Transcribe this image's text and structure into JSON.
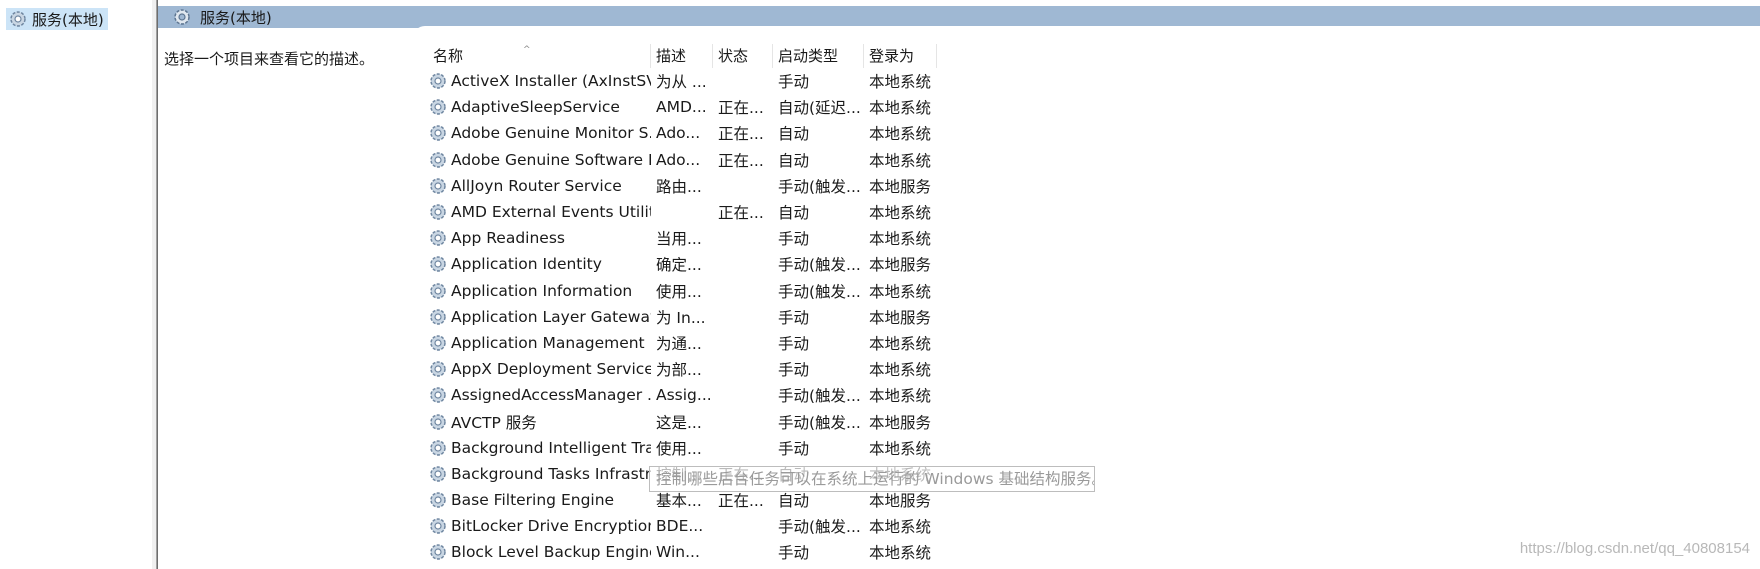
{
  "tree": {
    "root_label": "服务(本地)"
  },
  "header": {
    "title": "服务(本地)"
  },
  "description_panel": {
    "text": "选择一个项目来查看它的描述。"
  },
  "columns": [
    "名称",
    "描述",
    "状态",
    "启动类型",
    "登录为"
  ],
  "services": [
    {
      "name": "ActiveX Installer (AxInstSV)",
      "desc": "为从 ...",
      "status": "",
      "startup": "手动",
      "logon": "本地系统"
    },
    {
      "name": "AdaptiveSleepService",
      "desc": "AMD...",
      "status": "正在...",
      "startup": "自动(延迟...",
      "logon": "本地系统"
    },
    {
      "name": "Adobe Genuine Monitor S...",
      "desc": "Ado...",
      "status": "正在...",
      "startup": "自动",
      "logon": "本地系统"
    },
    {
      "name": "Adobe Genuine Software I...",
      "desc": "Ado...",
      "status": "正在...",
      "startup": "自动",
      "logon": "本地系统"
    },
    {
      "name": "AllJoyn Router Service",
      "desc": "路由...",
      "status": "",
      "startup": "手动(触发...",
      "logon": "本地服务"
    },
    {
      "name": "AMD External Events Utility",
      "desc": "",
      "status": "正在...",
      "startup": "自动",
      "logon": "本地系统"
    },
    {
      "name": "App Readiness",
      "desc": "当用...",
      "status": "",
      "startup": "手动",
      "logon": "本地系统"
    },
    {
      "name": "Application Identity",
      "desc": "确定...",
      "status": "",
      "startup": "手动(触发...",
      "logon": "本地服务"
    },
    {
      "name": "Application Information",
      "desc": "使用...",
      "status": "",
      "startup": "手动(触发...",
      "logon": "本地系统"
    },
    {
      "name": "Application Layer Gateway ...",
      "desc": "为 In...",
      "status": "",
      "startup": "手动",
      "logon": "本地服务"
    },
    {
      "name": "Application Management",
      "desc": "为通...",
      "status": "",
      "startup": "手动",
      "logon": "本地系统"
    },
    {
      "name": "AppX Deployment Service ...",
      "desc": "为部...",
      "status": "",
      "startup": "手动",
      "logon": "本地系统"
    },
    {
      "name": "AssignedAccessManager ...",
      "desc": "Assig...",
      "status": "",
      "startup": "手动(触发...",
      "logon": "本地系统"
    },
    {
      "name": "AVCTP 服务",
      "desc": "这是...",
      "status": "",
      "startup": "手动(触发...",
      "logon": "本地服务"
    },
    {
      "name": "Background Intelligent Tra...",
      "desc": "使用...",
      "status": "",
      "startup": "手动",
      "logon": "本地系统"
    },
    {
      "name": "Background Tasks Infrastru...",
      "desc": "控制...",
      "status": "正在...",
      "startup": "自动",
      "logon": "本地系统"
    },
    {
      "name": "Base Filtering Engine",
      "desc": "基本...",
      "status": "正在...",
      "startup": "自动",
      "logon": "本地服务"
    },
    {
      "name": "BitLocker Drive Encryption ...",
      "desc": "BDE...",
      "status": "",
      "startup": "手动(触发...",
      "logon": "本地系统"
    },
    {
      "name": "Block Level Backup Engine ...",
      "desc": "Win...",
      "status": "",
      "startup": "手动",
      "logon": "本地系统"
    }
  ],
  "tooltip": {
    "text": "控制哪些后台任务可以在系统上运行的 Windows 基础结构服务。"
  },
  "watermark": {
    "text": "https://blog.csdn.net/qq_40808154"
  },
  "icons": {
    "service": "gear-icon"
  }
}
